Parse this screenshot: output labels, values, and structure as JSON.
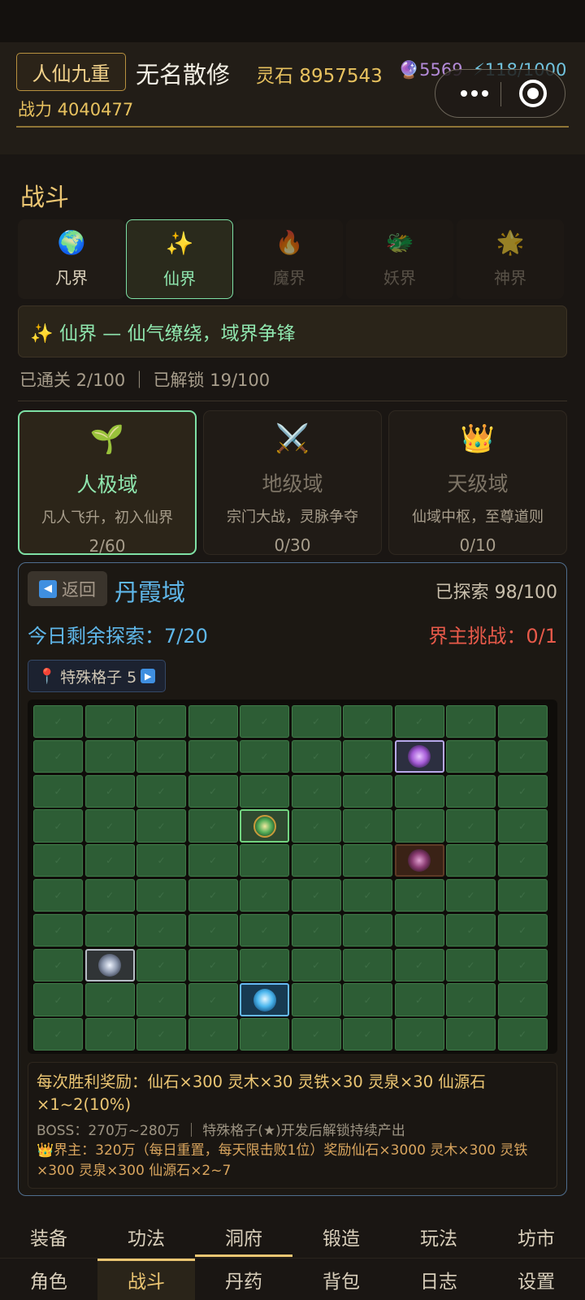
{
  "header": {
    "rank": "人仙九重",
    "player_name": "无名散修",
    "spirit_stone": "灵石 8957543",
    "gem": "🔮5569",
    "energy": "⚡118/1000",
    "power": "战力 4040477"
  },
  "section_title": "战斗",
  "realm_tabs": [
    {
      "icon": "🌍",
      "label": "凡界"
    },
    {
      "icon": "✨",
      "label": "仙界"
    },
    {
      "icon": "🔥",
      "label": "魔界"
    },
    {
      "icon": "🐲",
      "label": "妖界"
    },
    {
      "icon": "🌟",
      "label": "神界"
    }
  ],
  "banner": "✨ 仙界 — 仙气缭绕，域界争锋",
  "progress": "已通关 2/100 ｜ 已解锁 19/100",
  "domains": [
    {
      "icon": "🌱",
      "name": "人极域",
      "desc": "凡人飞升，初入仙界",
      "count": "2/60"
    },
    {
      "icon": "⚔️",
      "name": "地级域",
      "desc": "宗门大战，灵脉争夺",
      "count": "0/30"
    },
    {
      "icon": "👑",
      "name": "天级域",
      "desc": "仙域中枢，至尊道则",
      "count": "0/10"
    }
  ],
  "panel": {
    "back_label": "返回",
    "area_name": "丹霞域",
    "explored": "已探索 98/100",
    "today_remaining": "今日剩余探索：7/20",
    "boss_challenge": "界主挑战：0/1",
    "special_cells": "特殊格子 5",
    "reward_line": "每次胜利奖励：仙石×300  灵木×30  灵铁×30  灵泉×30  仙源石×1~2(10%)",
    "boss_line": "BOSS：270万~280万 ｜ 特殊格子(★)开发后解锁持续产出",
    "lord_line": "👑界主：320万（每日重置，每天限击败1位）奖励仙石×3000 灵木×300 灵铁×300 灵泉×300 仙源石×2~7"
  },
  "grid_special": [
    {
      "row": 1,
      "col": 7,
      "kind": "purple"
    },
    {
      "row": 3,
      "col": 4,
      "kind": "green"
    },
    {
      "row": 4,
      "col": 7,
      "kind": "dark"
    },
    {
      "row": 7,
      "col": 1,
      "kind": "silver"
    },
    {
      "row": 8,
      "col": 4,
      "kind": "blue"
    }
  ],
  "nav_top": [
    "装备",
    "功法",
    "洞府",
    "锻造",
    "玩法",
    "坊市"
  ],
  "nav_bottom": [
    "角色",
    "战斗",
    "丹药",
    "背包",
    "日志",
    "设置"
  ]
}
